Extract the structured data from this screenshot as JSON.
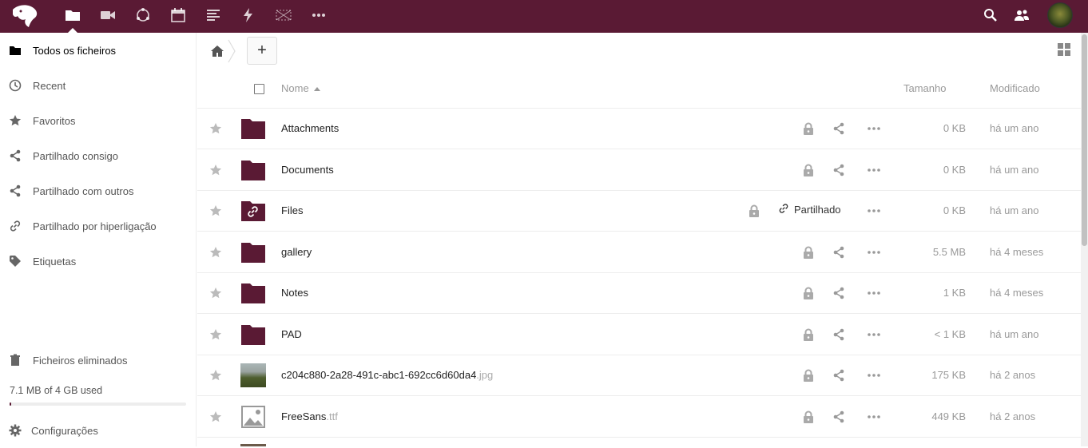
{
  "header": {
    "apps": [
      {
        "name": "files-icon"
      },
      {
        "name": "video-icon"
      },
      {
        "name": "circles-icon"
      },
      {
        "name": "calendar-icon"
      },
      {
        "name": "notes-icon"
      },
      {
        "name": "activity-icon"
      },
      {
        "name": "gallery-icon"
      },
      {
        "name": "more-apps-icon"
      }
    ]
  },
  "sidebar": {
    "items": [
      {
        "label": "Todos os ficheiros",
        "icon": "folder-icon"
      },
      {
        "label": "Recent",
        "icon": "clock-icon"
      },
      {
        "label": "Favoritos",
        "icon": "star-icon"
      },
      {
        "label": "Partilhado consigo",
        "icon": "share-icon"
      },
      {
        "label": "Partilhado com outros",
        "icon": "share-icon"
      },
      {
        "label": "Partilhado por hiperligação",
        "icon": "link-icon"
      },
      {
        "label": "Etiquetas",
        "icon": "tag-icon"
      }
    ],
    "deleted_label": "Ficheiros eliminados",
    "quota_text": "7.1 MB of 4 GB used",
    "quota_fraction": 0.002,
    "settings_label": "Configurações"
  },
  "main": {
    "add_label": "+",
    "columns": {
      "name": "Nome",
      "size": "Tamanho",
      "modified": "Modificado"
    },
    "files": [
      {
        "name": "Attachments",
        "ext": "",
        "type": "folder",
        "size": "0 KB",
        "modified": "há um ano",
        "shared": false
      },
      {
        "name": "Documents",
        "ext": "",
        "type": "folder",
        "size": "0 KB",
        "modified": "há um ano",
        "shared": false
      },
      {
        "name": "Files",
        "ext": "",
        "type": "folder-link",
        "size": "0 KB",
        "modified": "há um ano",
        "shared": true,
        "shared_label": "Partilhado"
      },
      {
        "name": "gallery",
        "ext": "",
        "type": "folder",
        "size": "5.5 MB",
        "modified": "há 4 meses",
        "shared": false
      },
      {
        "name": "Notes",
        "ext": "",
        "type": "folder",
        "size": "1 KB",
        "modified": "há 4 meses",
        "shared": false
      },
      {
        "name": "PAD",
        "ext": "",
        "type": "folder",
        "size": "< 1 KB",
        "modified": "há um ano",
        "shared": false
      },
      {
        "name": "c204c880-2a28-491c-abc1-692cc6d60da4",
        "ext": ".jpg",
        "type": "photo",
        "size": "175 KB",
        "modified": "há 2 anos",
        "shared": false
      },
      {
        "name": "FreeSans",
        "ext": ".ttf",
        "type": "image-file",
        "size": "449 KB",
        "modified": "há 2 anos",
        "shared": false
      }
    ]
  },
  "colors": {
    "brand": "#5a1a34"
  }
}
